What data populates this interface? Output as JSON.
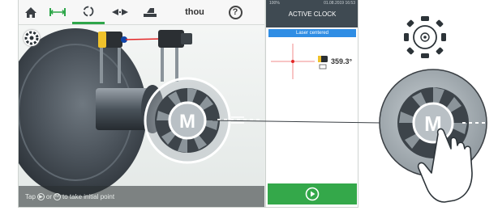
{
  "toolbar": {
    "items": [
      {
        "name": "home-icon",
        "label": ""
      },
      {
        "name": "dimensions-icon",
        "label": ""
      },
      {
        "name": "measure-icon",
        "label": ""
      },
      {
        "name": "results-icon",
        "label": ""
      },
      {
        "name": "move-icon",
        "label": ""
      }
    ],
    "units_label": "thou",
    "help_label": "?",
    "active_color": "#2ea64a"
  },
  "panel": {
    "status_left": "100%",
    "status_right": "01.08.2019 16:53",
    "title": "ACTIVE CLOCK",
    "laser_status": "Laser centered",
    "angle_value": "359.3°",
    "header_color": "#3f4a52",
    "laser_color": "#2f8de4",
    "button_color": "#34a84a"
  },
  "viewport": {
    "hub_label": "M",
    "hint": {
      "prefix": "Tap",
      "middle": "or",
      "suffix": "to take initial point"
    }
  },
  "callout": {
    "hub_label": "M"
  }
}
